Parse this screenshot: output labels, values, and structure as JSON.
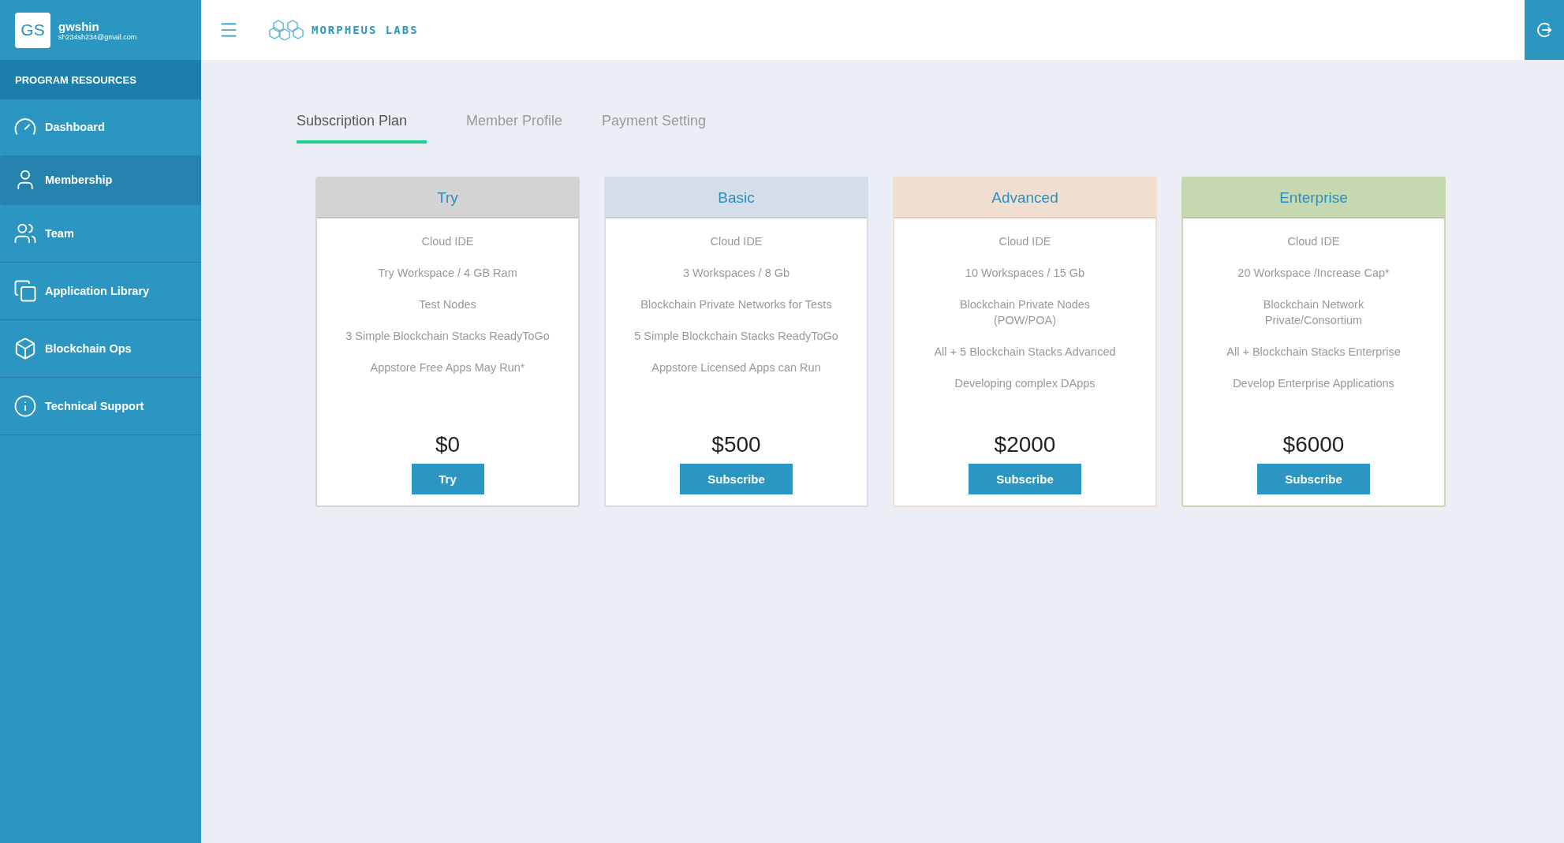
{
  "user": {
    "initials": "GS",
    "name": "gwshin",
    "email": "sh234sh234@gmail.com"
  },
  "sidebar": {
    "heading": "PROGRAM RESOURCES",
    "items": [
      {
        "label": "Dashboard",
        "selected": false
      },
      {
        "label": "Membership",
        "selected": true
      },
      {
        "label": "Team",
        "selected": false
      },
      {
        "label": "Application Library",
        "selected": false
      },
      {
        "label": "Blockchain Ops",
        "selected": false
      },
      {
        "label": "Technical Support",
        "selected": false
      }
    ]
  },
  "header": {
    "logo_text": "MORPHEUS LABS"
  },
  "tabs": [
    {
      "label": "Subscription Plan",
      "selected": true
    },
    {
      "label": "Member Profile",
      "selected": false
    },
    {
      "label": "Payment Setting",
      "selected": false
    }
  ],
  "plans": [
    {
      "name": "Try",
      "color": "#d3d3d3",
      "features": [
        "Cloud IDE",
        "Try Workspace / 4 GB Ram",
        "Test Nodes",
        "3 Simple Blockchain Stacks ReadyToGo",
        "Appstore Free Apps May Run*"
      ],
      "price": "$0",
      "button": "Try"
    },
    {
      "name": "Basic",
      "color": "#d3deea",
      "features": [
        "Cloud IDE",
        "3 Workspaces / 8 Gb",
        "Blockchain Private Networks for Tests",
        "5 Simple Blockchain Stacks ReadyToGo",
        "Appstore Licensed Apps can Run"
      ],
      "price": "$500",
      "button": "Subscribe"
    },
    {
      "name": "Advanced",
      "color": "#f0ded0",
      "features": [
        "Cloud IDE",
        "10 Workspaces / 15 Gb",
        "Blockchain Private Nodes\n(POW/POA)",
        "All + 5 Blockchain Stacks Advanced",
        "Developing complex DApps"
      ],
      "price": "$2000",
      "button": "Subscribe"
    },
    {
      "name": "Enterprise",
      "color": "#c5d8b0",
      "features": [
        "Cloud IDE",
        "20 Workspace /Increase Cap*",
        "Blockchain Network\nPrivate/Consortium",
        "All + Blockchain Stacks Enterprise",
        "Develop Enterprise Applications"
      ],
      "price": "$6000",
      "button": "Subscribe"
    }
  ]
}
